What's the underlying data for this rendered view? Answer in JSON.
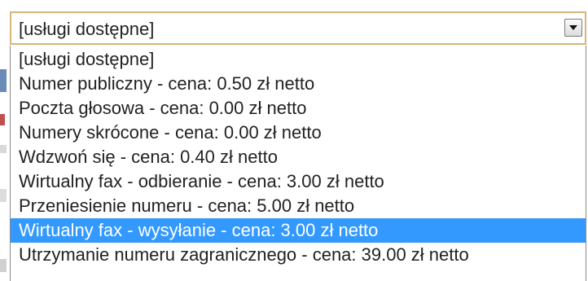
{
  "select": {
    "value": "[usługi dostępne]",
    "arrow_icon": "chevron-down-icon"
  },
  "dropdown": {
    "highlight_color": "#3399ff",
    "options": [
      {
        "label": "[usługi dostępne]",
        "selected": false
      },
      {
        "label": "Numer publiczny - cena: 0.50 zł netto",
        "selected": false
      },
      {
        "label": "Poczta głosowa - cena: 0.00 zł netto",
        "selected": false
      },
      {
        "label": "Numery skrócone - cena: 0.00 zł netto",
        "selected": false
      },
      {
        "label": "Wdzwoń się - cena: 0.40 zł netto",
        "selected": false
      },
      {
        "label": "Wirtualny fax - odbieranie - cena: 3.00 zł netto",
        "selected": false
      },
      {
        "label": "Przeniesienie numeru - cena: 5.00 zł netto",
        "selected": false
      },
      {
        "label": "Wirtualny fax - wysyłanie - cena: 3.00 zł netto",
        "selected": true
      },
      {
        "label": "Utrzymanie numeru zagranicznego - cena: 39.00 zł netto",
        "selected": false
      }
    ]
  }
}
